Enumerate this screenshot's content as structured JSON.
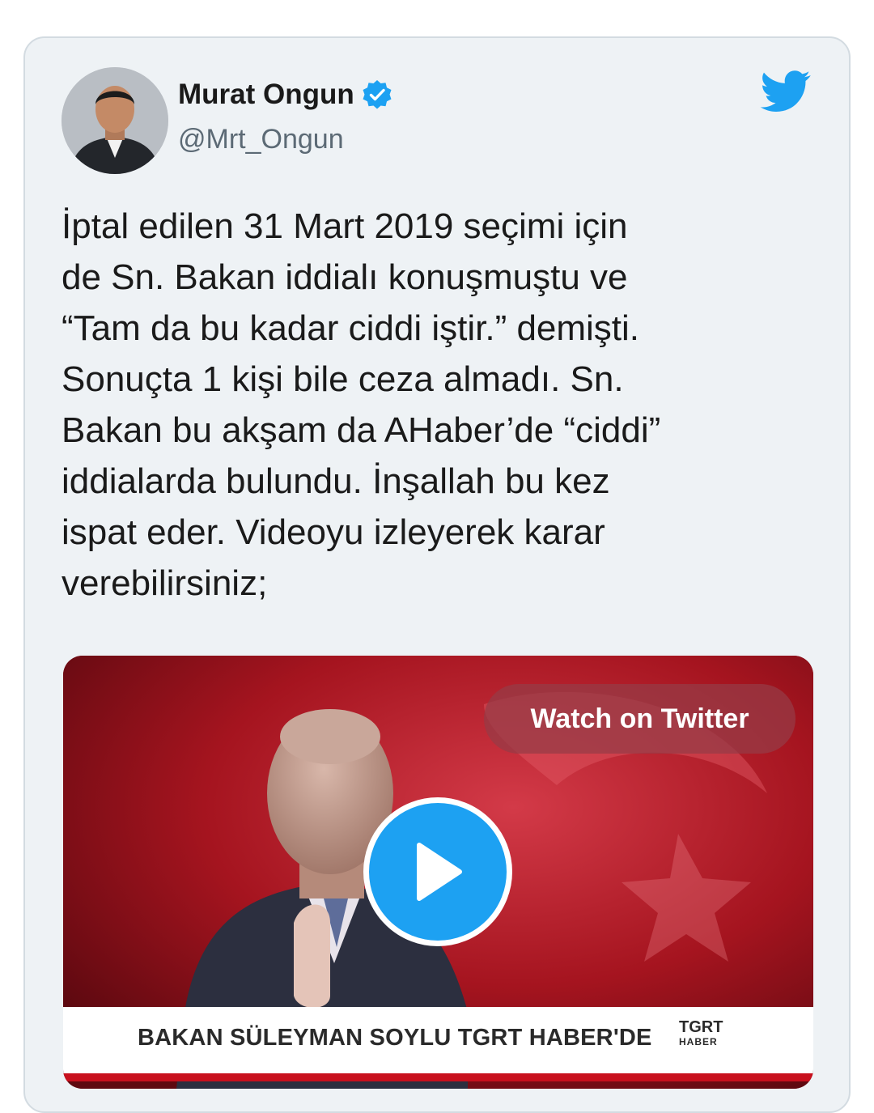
{
  "tweet": {
    "author": {
      "display_name": "Murat Ongun",
      "handle": "@Mrt_Ongun",
      "verified": true
    },
    "text": "İptal edilen 31 Mart 2019 seçimi için\nde Sn. Bakan iddialı konuşmuştu ve\n“Tam da bu kadar ciddi iştir.” demişti.\nSonuçta 1 kişi bile ceza almadı. Sn.\nBakan bu akşam da AHaber’de “ciddi”\niddialarda bulundu. İnşallah bu kez\nispat eder. Videoyu izleyerek karar\nverebilirsiniz;",
    "media": {
      "watch_label": "Watch on Twitter",
      "ticker_text": "BAKAN SÜLEYMAN SOYLU TGRT HABER'DE",
      "channel_logo_top": "TGRT",
      "channel_logo_bottom": "HABER"
    }
  },
  "colors": {
    "twitter_blue": "#1da1f2",
    "card_background": "#eef2f5",
    "card_border": "#d3dbe1",
    "ticker_red": "#c8101d"
  },
  "icons": [
    "twitter-bird-icon",
    "verified-badge-icon",
    "play-icon"
  ]
}
